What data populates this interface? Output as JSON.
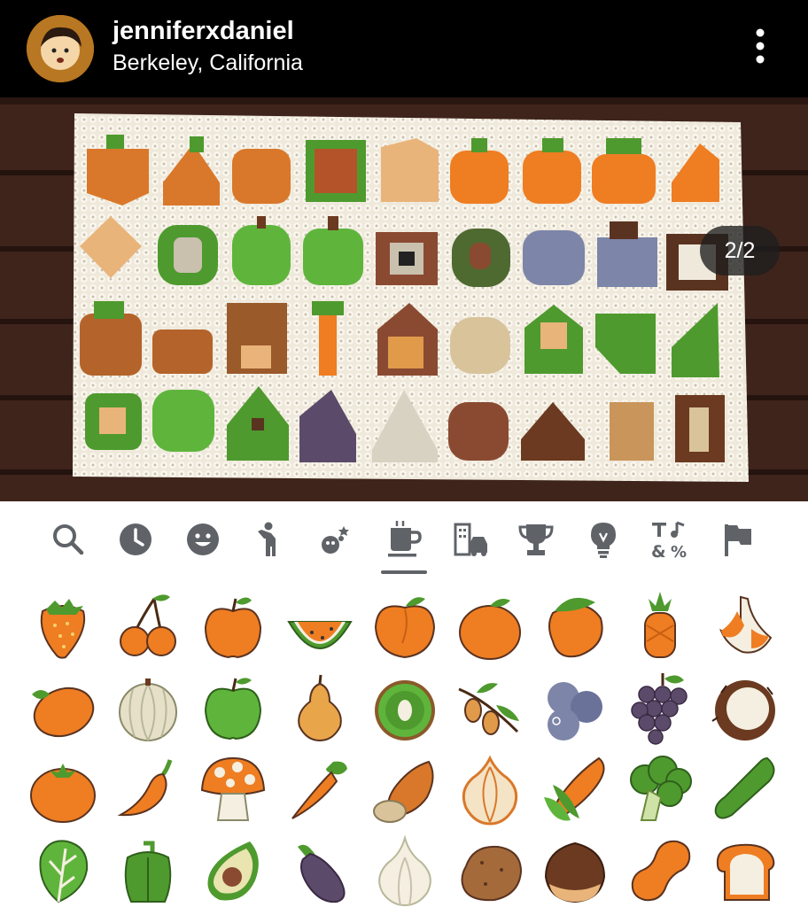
{
  "post": {
    "username": "jenniferxdaniel",
    "location": "Berkeley, California",
    "photo_counter": "2/2"
  },
  "emoji_keyboard": {
    "categories": [
      {
        "name": "search-icon"
      },
      {
        "name": "recent-clock-icon"
      },
      {
        "name": "smiley-icon"
      },
      {
        "name": "person-icon"
      },
      {
        "name": "animals-nature-icon"
      },
      {
        "name": "food-drink-icon",
        "selected": true
      },
      {
        "name": "travel-places-icon"
      },
      {
        "name": "activities-trophy-icon"
      },
      {
        "name": "objects-lightbulb-icon"
      },
      {
        "name": "symbols-icon"
      },
      {
        "name": "flags-icon"
      }
    ],
    "emoji_rows": [
      [
        "strawberry",
        "cherries",
        "tangerine-apple",
        "watermelon",
        "peach",
        "tangerine",
        "mango",
        "pineapple",
        "banana"
      ],
      [
        "lemon",
        "melon",
        "green-apple",
        "pear",
        "kiwi",
        "olive",
        "blueberries",
        "grapes",
        "coconut"
      ],
      [
        "tomato",
        "hot-pepper",
        "mushroom",
        "carrot",
        "roasted-sweet-potato",
        "onion",
        "corn",
        "broccoli",
        "cucumber"
      ],
      [
        "leafy-green",
        "bell-pepper",
        "avocado",
        "eggplant",
        "garlic",
        "potato",
        "chestnut",
        "peanuts",
        "bread"
      ]
    ]
  },
  "colors": {
    "header_bg": "#000000",
    "accent_orange": "#ef7d22",
    "icon_gray": "#5f6368",
    "wood": "#4a2a1f"
  }
}
